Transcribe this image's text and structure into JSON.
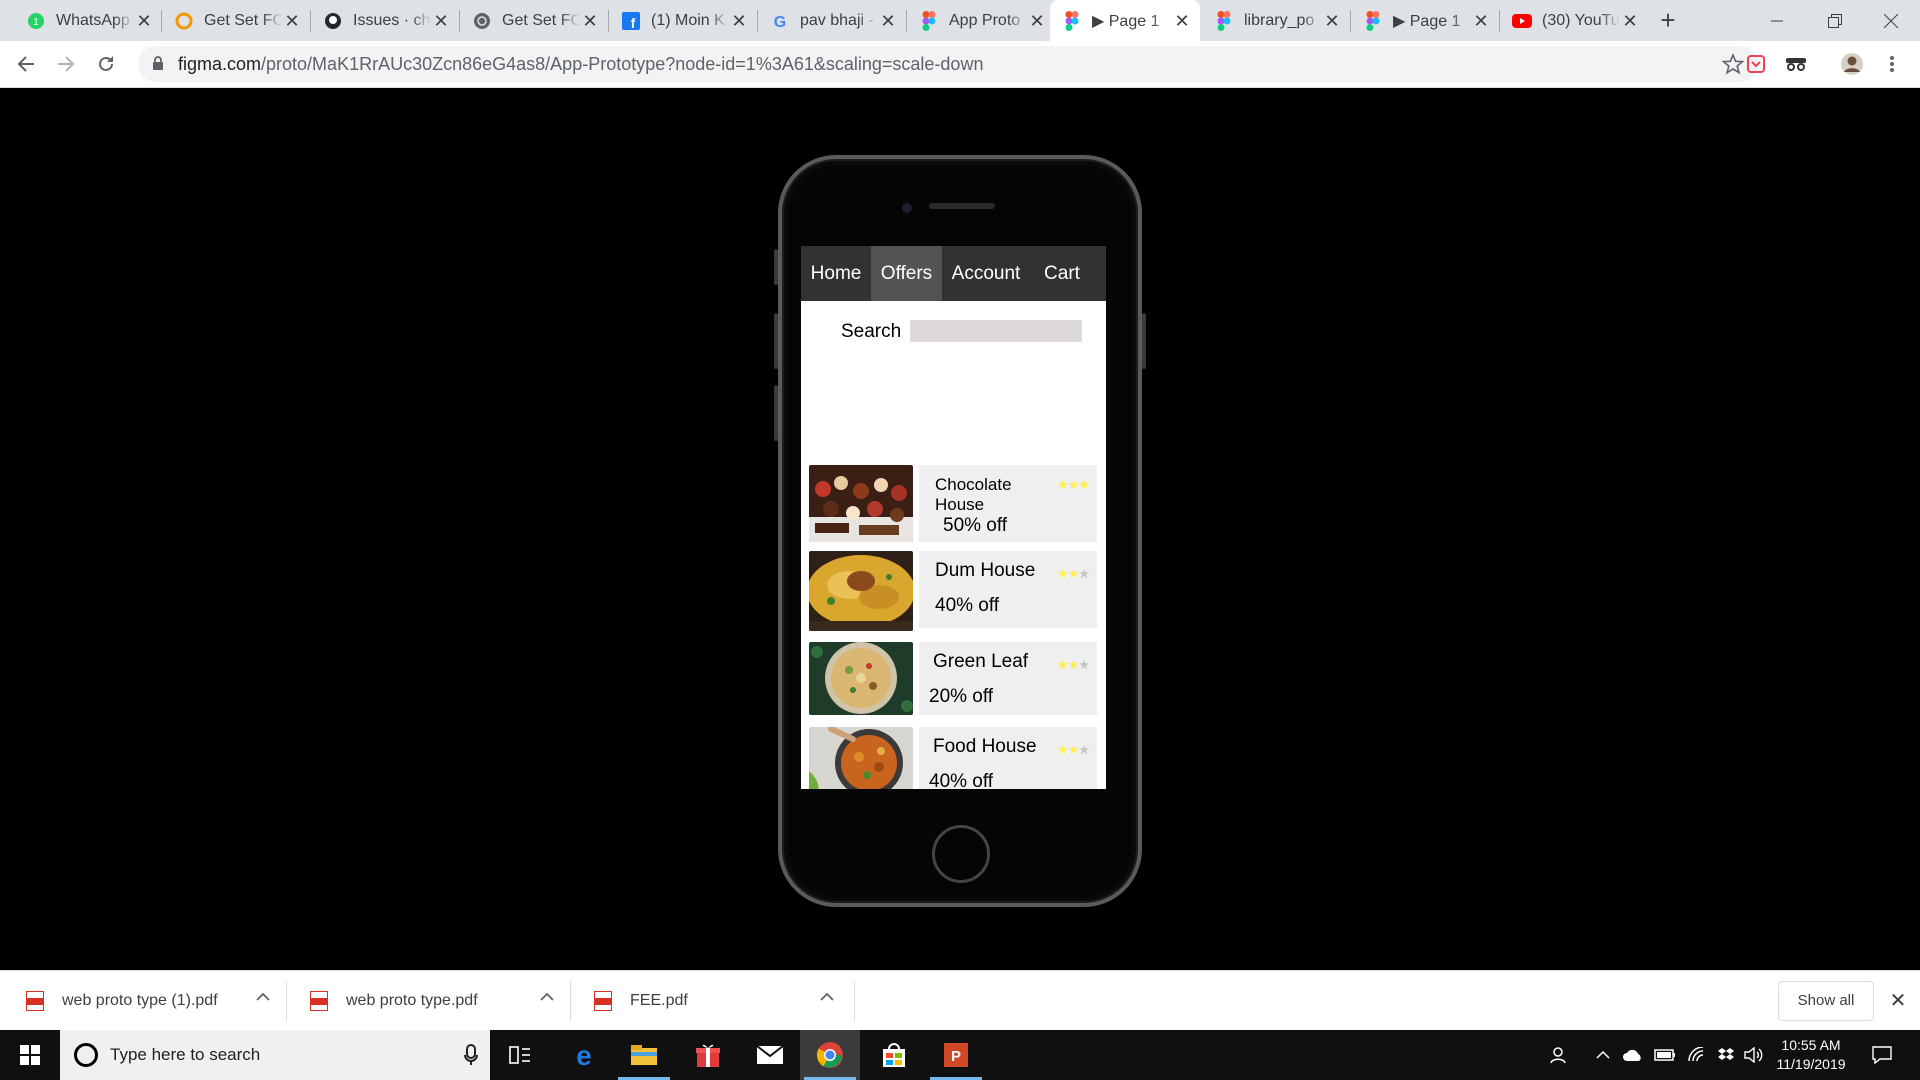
{
  "browser": {
    "tabs": [
      {
        "title": "WhatsApp",
        "icon": "whatsapp-icon",
        "active": false
      },
      {
        "title": "Get Set FOSS",
        "icon": "getsetfoss-icon",
        "active": false
      },
      {
        "title": "Issues · ch",
        "icon": "github-icon",
        "active": false
      },
      {
        "title": "Get Set FOSS",
        "icon": "globe-icon",
        "active": false
      },
      {
        "title": "(1) Moin K",
        "icon": "facebook-icon",
        "active": false
      },
      {
        "title": "pav bhaji -",
        "icon": "google-icon",
        "active": false
      },
      {
        "title": "App Proto",
        "icon": "figma-icon",
        "active": false
      },
      {
        "title": "▶ Page 1",
        "icon": "figma-icon",
        "active": true
      },
      {
        "title": "library_po",
        "icon": "figma-icon",
        "active": false
      },
      {
        "title": "▶ Page 1",
        "icon": "figma-icon",
        "active": false
      },
      {
        "title": "(30) YouTu",
        "icon": "youtube-icon",
        "active": false
      }
    ],
    "url_host": "figma.com",
    "url_path": "/proto/MaK1RrAUc30Zcn86eG4as8/App-Prototype?node-id=1%3A61&scaling=scale-down"
  },
  "app": {
    "nav": [
      "Home",
      "Offers",
      "Account",
      "Cart"
    ],
    "active_nav": "Offers",
    "search_label": "Search",
    "search_value": "",
    "restaurants": [
      {
        "name": "Chocolate House",
        "offer": "50% off",
        "rating": 3,
        "max_rating": 3,
        "image": "dessert-photo"
      },
      {
        "name": "Dum House",
        "offer": "40% off",
        "rating": 2,
        "max_rating": 3,
        "image": "biryani-photo"
      },
      {
        "name": "Green Leaf",
        "offer": "20% off",
        "rating": 2,
        "max_rating": 3,
        "image": "pulao-photo"
      },
      {
        "name": "Food House",
        "offer": "40% off",
        "rating": 2,
        "max_rating": 3,
        "image": "curry-photo"
      }
    ]
  },
  "downloads": {
    "items": [
      "web proto type (1).pdf",
      "web proto type.pdf",
      "FEE.pdf"
    ],
    "show_all": "Show all"
  },
  "taskbar": {
    "search_placeholder": "Type here to search",
    "time": "10:55 AM",
    "date": "11/19/2019"
  },
  "colors": {
    "nav_bg": "#333232",
    "nav_active": "#545252",
    "star_on": "#ffef4a",
    "star_off": "#c4c4c4",
    "card_bg": "#efefef"
  }
}
